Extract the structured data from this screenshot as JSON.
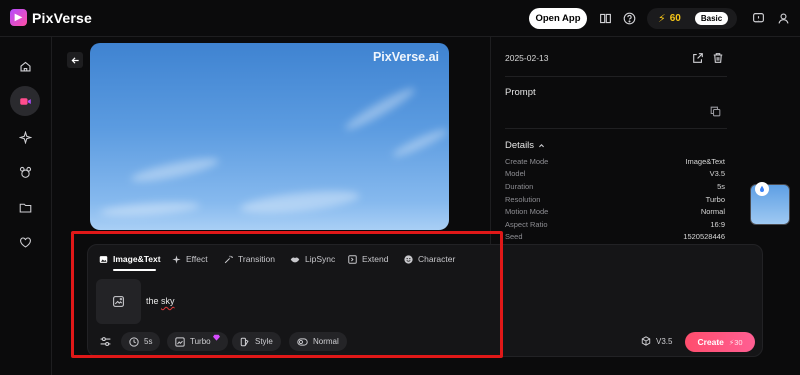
{
  "app": {
    "name": "PixVerse"
  },
  "header": {
    "open_app_label": "Open App",
    "credits": "60",
    "plan_badge": "Basic",
    "icons": [
      "book-icon",
      "help-icon",
      "notification-icon",
      "user-icon"
    ]
  },
  "sidebar": {
    "items": [
      {
        "icon": "home-icon",
        "active": false
      },
      {
        "icon": "video-camera-icon",
        "active": true
      },
      {
        "icon": "sparkle-icon",
        "active": false
      },
      {
        "icon": "mascot-icon",
        "active": false
      },
      {
        "icon": "folder-icon",
        "active": false
      },
      {
        "icon": "heart-icon",
        "active": false
      }
    ]
  },
  "preview": {
    "watermark": "PixVerse.ai"
  },
  "details": {
    "date": "2025-02-13",
    "prompt_label": "Prompt",
    "details_label": "Details",
    "rows": [
      {
        "key": "Create Mode",
        "value": "Image&Text"
      },
      {
        "key": "Model",
        "value": "V3.5"
      },
      {
        "key": "Duration",
        "value": "5s"
      },
      {
        "key": "Resolution",
        "value": "Turbo"
      },
      {
        "key": "Motion Mode",
        "value": "Normal"
      },
      {
        "key": "Aspect Ratio",
        "value": "16:9"
      },
      {
        "key": "Seed",
        "value": "1520528446"
      }
    ]
  },
  "composer": {
    "tabs": [
      {
        "label": "Image&Text",
        "icon": "image-icon",
        "active": true
      },
      {
        "label": "Effect",
        "icon": "sparkle-icon",
        "active": false
      },
      {
        "label": "Transition",
        "icon": "magic-wand-icon",
        "active": false
      },
      {
        "label": "LipSync",
        "icon": "lips-icon",
        "active": false
      },
      {
        "label": "Extend",
        "icon": "extend-icon",
        "active": false
      },
      {
        "label": "Character",
        "icon": "smiley-icon",
        "active": false
      }
    ],
    "prompt_prefix": "the ",
    "prompt_misspelled": "sky",
    "options": {
      "duration": "5s",
      "quality": "Turbo",
      "style": "Style",
      "motion": "Normal"
    },
    "model": "V3.5",
    "create_label": "Create",
    "create_cost": "30"
  },
  "colors": {
    "accent_create": "#ff4d6d",
    "credits": "#f5c518",
    "highlight": "#e01818"
  }
}
